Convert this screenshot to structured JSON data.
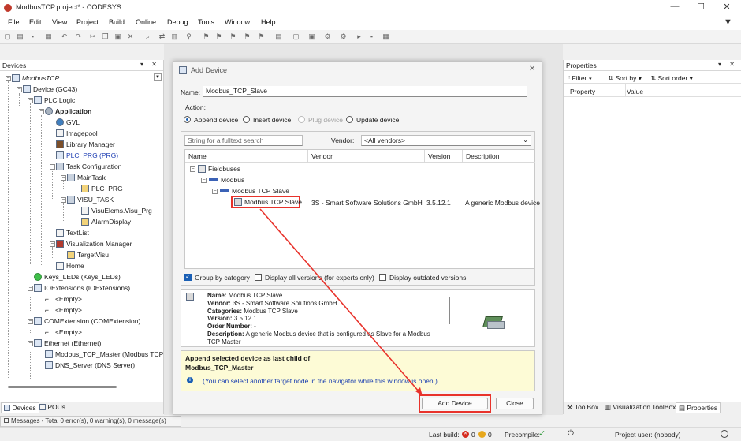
{
  "window": {
    "title": "ModbusTCP.project* - CODESYS",
    "min_glyph": "—",
    "max_glyph": "☐",
    "close_glyph": "✕"
  },
  "menu": [
    "File",
    "Edit",
    "View",
    "Project",
    "Build",
    "Online",
    "Debug",
    "Tools",
    "Window",
    "Help"
  ],
  "devices_panel": {
    "title": "Devices",
    "controls": "▾ ✕",
    "tree": [
      {
        "label": "ModbusTCP",
        "style": "italic"
      },
      {
        "label": "Device (GC43)"
      },
      {
        "label": "PLC Logic"
      },
      {
        "label": "Application",
        "style": "bold"
      },
      {
        "label": "GVL"
      },
      {
        "label": "Imagepool"
      },
      {
        "label": "Library Manager"
      },
      {
        "label": "PLC_PRG (PRG)",
        "style": "link"
      },
      {
        "label": "Task Configuration"
      },
      {
        "label": "MainTask"
      },
      {
        "label": "PLC_PRG"
      },
      {
        "label": "VISU_TASK"
      },
      {
        "label": "VisuElems.Visu_Prg"
      },
      {
        "label": "AlarmDisplay"
      },
      {
        "label": "TextList"
      },
      {
        "label": "Visualization Manager"
      },
      {
        "label": "TargetVisu"
      },
      {
        "label": "Home"
      },
      {
        "label": "Keys_LEDs (Keys_LEDs)"
      },
      {
        "label": "IOExtensions (IOExtensions)"
      },
      {
        "label": "<Empty>"
      },
      {
        "label": "<Empty>"
      },
      {
        "label": "COMExtension (COMExtension)"
      },
      {
        "label": "<Empty>"
      },
      {
        "label": "Ethernet (Ethernet)"
      },
      {
        "label": "Modbus_TCP_Master (Modbus TCP Ma"
      },
      {
        "label": "DNS_Server (DNS Server)"
      }
    ],
    "tabs": [
      "Devices",
      "POUs"
    ]
  },
  "messages_bar": "Messages - Total 0 error(s), 0 warning(s), 0 message(s)",
  "statusbar": {
    "last_build_label": "Last build:",
    "errors": "0",
    "warnings": "0",
    "precompile_label": "Precompile:",
    "project_user": "Project user: (nobody)"
  },
  "properties_panel": {
    "title": "Properties",
    "controls": "▾ ✕",
    "filter": "Filter",
    "sort_by": "Sort by",
    "sort_order": "Sort order",
    "col_property": "Property",
    "col_value": "Value",
    "tabs": [
      "ToolBox",
      "Visualization ToolBox",
      "Properties"
    ]
  },
  "dialog": {
    "title": "Add Device",
    "close_glyph": "✕",
    "name_label": "Name:",
    "name_value": "Modbus_TCP_Slave",
    "action_label": "Action:",
    "actions": [
      "Append device",
      "Insert device",
      "Plug device",
      "Update device"
    ],
    "search_placeholder": "String for a fulltext search",
    "vendor_label": "Vendor:",
    "vendor_value": "<All vendors>",
    "columns": [
      "Name",
      "Vendor",
      "Version",
      "Description"
    ],
    "tree": [
      {
        "name": "Fieldbuses"
      },
      {
        "name": "Modbus"
      },
      {
        "name": "Modbus TCP Slave"
      },
      {
        "name": "Modbus TCP Slave",
        "vendor": "3S - Smart Software Solutions GmbH",
        "version": "3.5.12.1",
        "description": "A generic Modbus device"
      }
    ],
    "options": [
      {
        "label": "Group by category",
        "checked": true
      },
      {
        "label": "Display all versions (for experts only)",
        "checked": false
      },
      {
        "label": "Display outdated versions",
        "checked": false
      }
    ],
    "info": {
      "name_key": "Name:",
      "name_val": "Modbus TCP Slave",
      "vendor_key": "Vendor:",
      "vendor_val": "3S - Smart Software Solutions GmbH",
      "categories_key": "Categories:",
      "categories_val": "Modbus TCP Slave",
      "version_key": "Version:",
      "version_val": "3.5.12.1",
      "order_key": "Order Number:",
      "order_val": "-",
      "description_key": "Description:",
      "description_val": "A generic Modbus device that is configured as Slave for a Modbus TCP Master"
    },
    "hint": {
      "line1": "Append selected device as last child of",
      "line2": "Modbus_TCP_Master",
      "note": "(You can select another target node in the navigator while this window is open.)"
    },
    "add_button": "Add Device",
    "close_button": "Close"
  },
  "colors": {
    "highlight": "#e8322b",
    "hint_bg": "#fdfbd6",
    "accent": "#1a5fb4"
  }
}
